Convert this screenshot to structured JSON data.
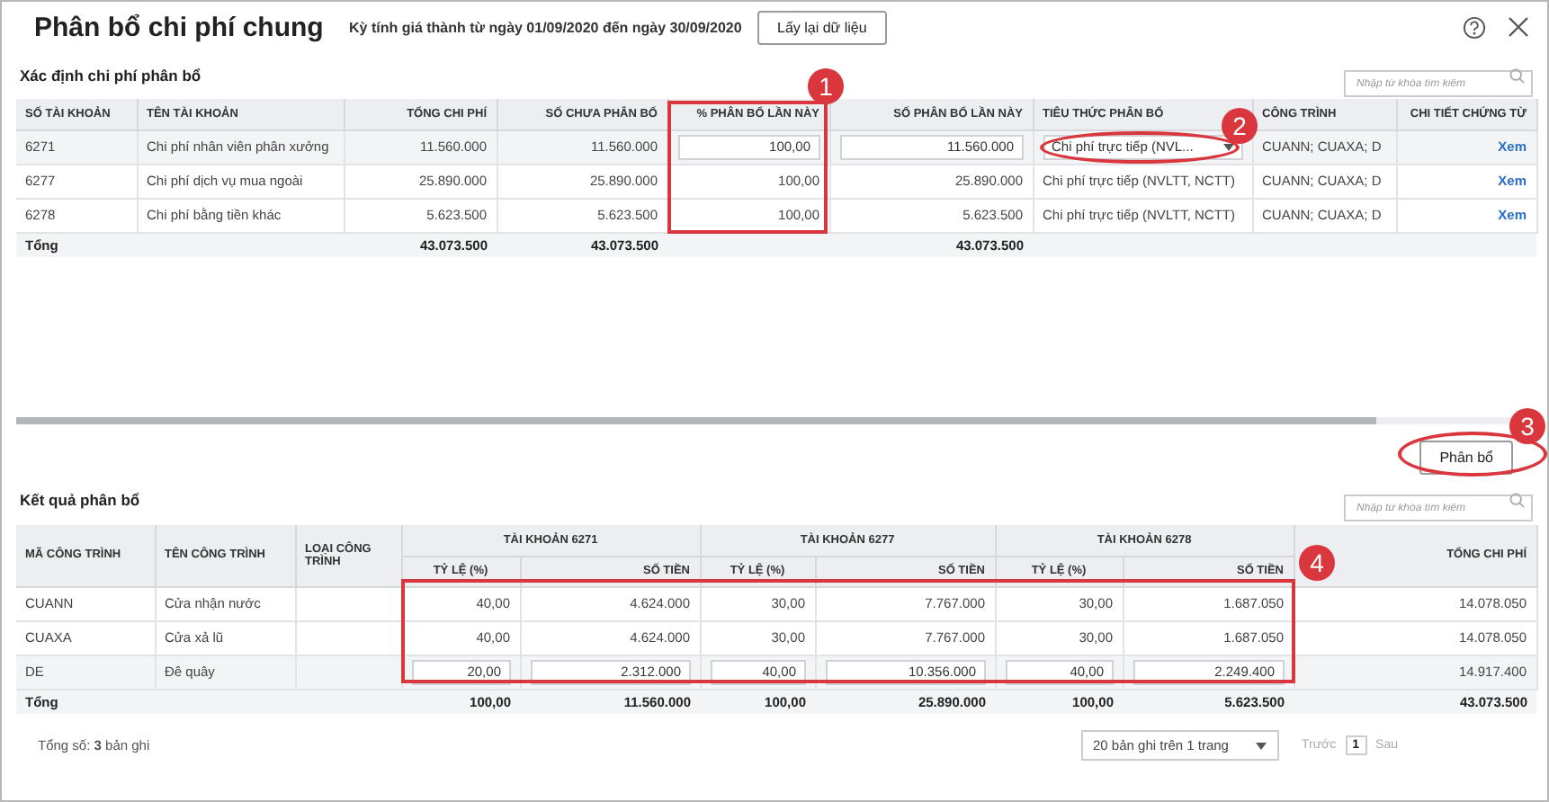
{
  "window": {
    "title": "Phân bổ chi phí chung",
    "period": "Kỳ tính giá thành từ ngày 01/09/2020 đến ngày 30/09/2020",
    "reload_button": "Lấy lại dữ liệu"
  },
  "section1": {
    "title": "Xác định chi phí phân bổ",
    "search": {
      "placeholder": "Nhập từ khóa tìm kiếm"
    },
    "columns": [
      "SỐ TÀI KHOẢN",
      "TÊN TÀI KHOẢN",
      "TỔNG CHI PHÍ",
      "SỐ CHƯA PHÂN BỔ",
      "% PHÂN BỔ LẦN NÀY",
      "SỐ PHÂN BỔ LẦN NÀY",
      "TIÊU THỨC PHÂN BỔ",
      "CÔNG TRÌNH",
      "CHI TIẾT CHỨNG TỪ"
    ],
    "rows": [
      {
        "account": "6271",
        "name": "Chi phí nhân viên phân xưởng",
        "total": "11.560.000",
        "unallocated": "11.560.000",
        "percent": "100,00",
        "allocated": "11.560.000",
        "criterion": "Chi phí trực tiếp (NVL...",
        "works": "CUANN; CUAXA; D",
        "detail": "Xem",
        "editing": true
      },
      {
        "account": "6277",
        "name": "Chi phí dịch vụ mua ngoài",
        "total": "25.890.000",
        "unallocated": "25.890.000",
        "percent": "100,00",
        "allocated": "25.890.000",
        "criterion": "Chi phí trực tiếp (NVLTT, NCTT)",
        "works": "CUANN; CUAXA; D",
        "detail": "Xem",
        "editing": false
      },
      {
        "account": "6278",
        "name": "Chi phí bằng tiền khác",
        "total": "5.623.500",
        "unallocated": "5.623.500",
        "percent": "100,00",
        "allocated": "5.623.500",
        "criterion": "Chi phí trực tiếp (NVLTT, NCTT)",
        "works": "CUANN; CUAXA; D",
        "detail": "Xem",
        "editing": false
      }
    ],
    "totals": {
      "label": "Tổng",
      "total": "43.073.500",
      "unallocated": "43.073.500",
      "allocated": "43.073.500"
    }
  },
  "allocate_button": "Phân bổ",
  "section2": {
    "title": "Kết quả phân bổ",
    "search": {
      "placeholder": "Nhập từ khóa tìm kiếm"
    },
    "columns": [
      "MÃ CÔNG TRÌNH",
      "TÊN CÔNG TRÌNH",
      "LOẠI CÔNG TRÌNH"
    ],
    "groups": [
      {
        "title": "TÀI KHOẢN 6271",
        "sub": [
          "TỶ LỆ (%)",
          "SỐ TIỀN"
        ]
      },
      {
        "title": "TÀI KHOẢN 6277",
        "sub": [
          "TỶ LỆ (%)",
          "SỐ TIỀN"
        ]
      },
      {
        "title": "TÀI KHOẢN 6278",
        "sub": [
          "TỶ LỆ (%)",
          "SỐ TIỀN"
        ]
      }
    ],
    "total_column": "TỔNG CHI PHÍ",
    "rows": [
      {
        "code": "CUANN",
        "name": "Cửa nhận nước",
        "values": [
          "40,00",
          "4.624.000",
          "30,00",
          "7.767.000",
          "30,00",
          "1.687.050"
        ],
        "total": "14.078.050",
        "editing": false
      },
      {
        "code": "CUAXA",
        "name": "Cửa xả lũ",
        "values": [
          "40,00",
          "4.624.000",
          "30,00",
          "7.767.000",
          "30,00",
          "1.687.050"
        ],
        "total": "14.078.050",
        "editing": false
      },
      {
        "code": "DE",
        "name": "Đê quây",
        "values": [
          "20,00",
          "2.312.000",
          "40,00",
          "10.356.000",
          "40,00",
          "2.249.400"
        ],
        "total": "14.917.400",
        "editing": true
      }
    ],
    "totals": {
      "label": "Tổng",
      "values": [
        "100,00",
        "11.560.000",
        "100,00",
        "25.890.000",
        "100,00",
        "5.623.500"
      ],
      "total": "43.073.500"
    }
  },
  "footer": {
    "record_count": "Tổng số: **3** bản ghi",
    "page_size": "20 bản ghi trên 1 trang",
    "prev": "Trước",
    "page": "1",
    "next": "Sau"
  },
  "annotations": [
    {
      "number": "1",
      "kind": "frame"
    },
    {
      "number": "2",
      "kind": "ellipse"
    },
    {
      "number": "3",
      "kind": "ellipse"
    },
    {
      "number": "4",
      "kind": "frame"
    }
  ]
}
